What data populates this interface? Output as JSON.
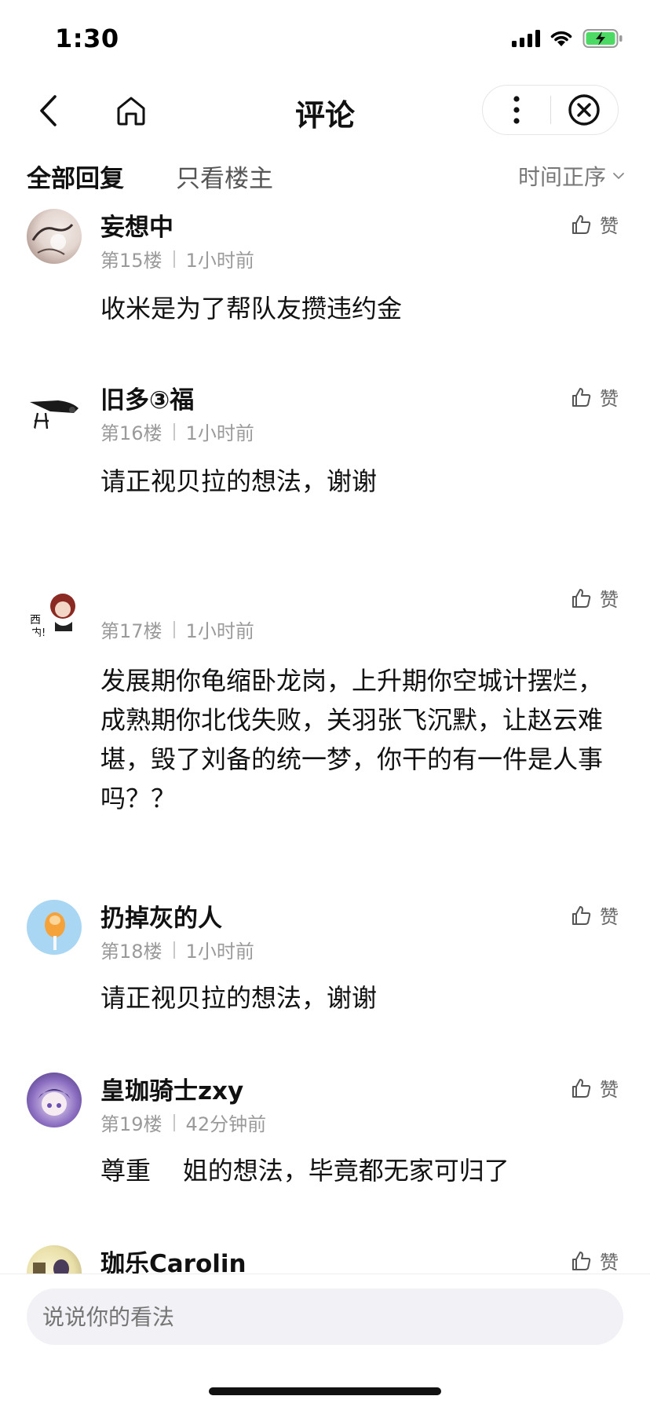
{
  "status_bar": {
    "time": "1:30"
  },
  "nav": {
    "title": "评论"
  },
  "filter": {
    "all_label": "全部回复",
    "op_label": "只看楼主",
    "sort_label": "时间正序"
  },
  "like_label": "赞",
  "comments": [
    {
      "name": "妄想中",
      "floor": "第15楼",
      "time": "1小时前",
      "text": "收米是为了帮队友攒违约金"
    },
    {
      "name": "旧多③福",
      "floor": "第16楼",
      "time": "1小时前",
      "text": "请正视贝拉的想法，谢谢"
    },
    {
      "name": "",
      "floor": "第17楼",
      "time": "1小时前",
      "text": "发展期你龟缩卧龙岗，上升期你空城计摆烂，成熟期你北伐失败，关羽张飞沉默，让赵云难堪，毁了刘备的统一梦，你干的有一件是人事吗？？"
    },
    {
      "name": "扔掉灰的人",
      "floor": "第18楼",
      "time": "1小时前",
      "text": "请正视贝拉的想法，谢谢"
    },
    {
      "name": "皇珈骑士zxy",
      "floor": "第19楼",
      "time": "42分钟前",
      "text": "尊重    姐的想法，毕竟都无家可归了"
    },
    {
      "name": "珈乐Carolin"
    }
  ],
  "input": {
    "placeholder": "说说你的看法"
  }
}
